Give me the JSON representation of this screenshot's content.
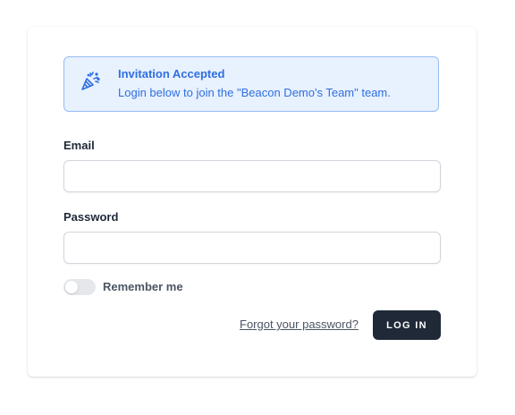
{
  "alert": {
    "icon": "party-popper-icon",
    "title": "Invitation Accepted",
    "message": "Login below to join the \"Beacon Demo's Team\" team.",
    "color": "#2f6fe0",
    "background": "#e8f1fe"
  },
  "form": {
    "email_label": "Email",
    "email_value": "",
    "password_label": "Password",
    "password_value": "",
    "remember_label": "Remember me",
    "remember_checked": false,
    "forgot_link": "Forgot your password?",
    "login_button": "LOG IN"
  },
  "colors": {
    "primary_button": "#1f2937"
  }
}
